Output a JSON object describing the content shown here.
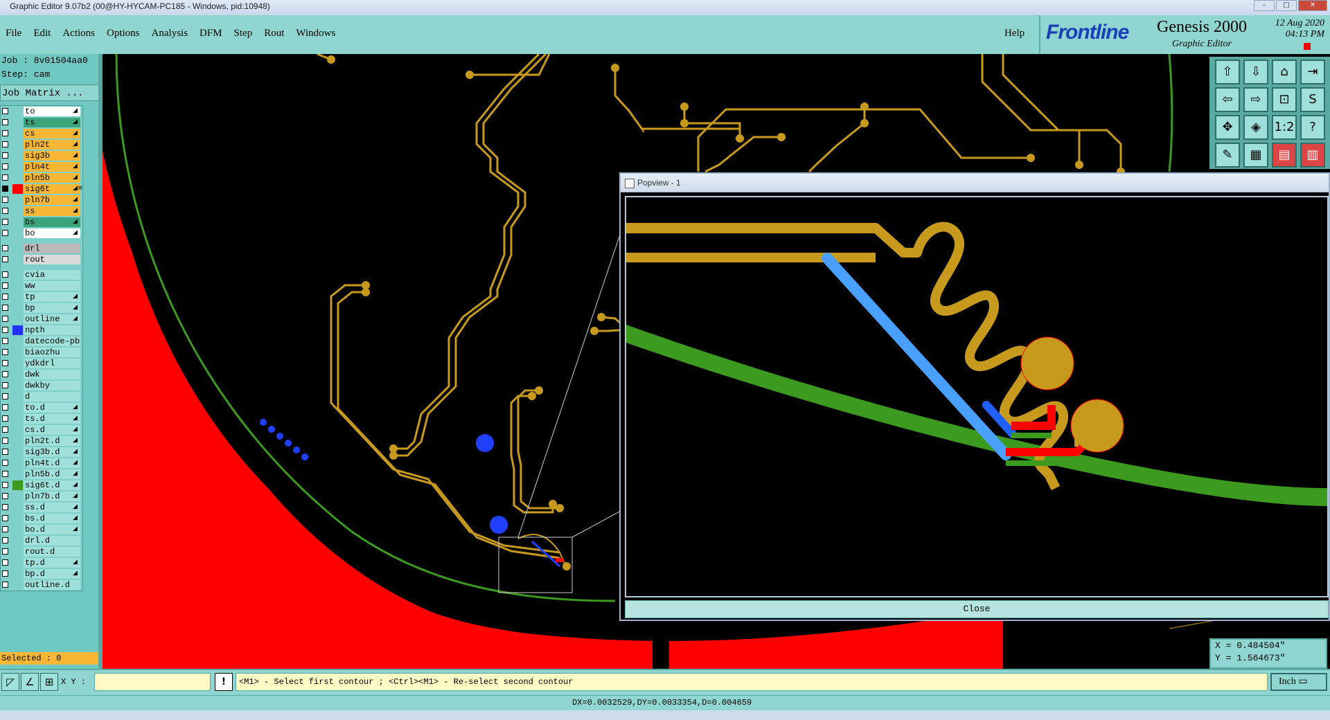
{
  "window": {
    "title": "Graphic Editor 9.07b2 (00@HY-HYCAM-PC185 - Windows, pid:10948)"
  },
  "menu": {
    "items": [
      "File",
      "Edit",
      "Actions",
      "Options",
      "Analysis",
      "DFM",
      "Step",
      "Rout",
      "Windows"
    ],
    "help": "Help"
  },
  "brand": {
    "logo": "Frontline",
    "product": "Genesis 2000",
    "subtitle": "Graphic Editor",
    "date": "12 Aug 2020",
    "time": "04:13 PM"
  },
  "job": {
    "job_label": "Job : 8v01504aa0",
    "step_label": "Step: cam",
    "matrix_button": "Job Matrix ..."
  },
  "layers": [
    {
      "name": "to",
      "color": "#ffffff",
      "sel": "",
      "flag": "◢"
    },
    {
      "name": "ts",
      "color": "#3aa57a",
      "sel": "",
      "flag": "◢"
    },
    {
      "name": "cs",
      "color": "#f7b735",
      "sel": "",
      "flag": "◢"
    },
    {
      "name": "pln2t",
      "color": "#f7b735",
      "sel": "",
      "flag": "◢"
    },
    {
      "name": "sig3b",
      "color": "#f7b735",
      "sel": "",
      "flag": "◢"
    },
    {
      "name": "pln4t",
      "color": "#f7b735",
      "sel": "",
      "flag": "◢"
    },
    {
      "name": "pln5b",
      "color": "#f7b735",
      "sel": "",
      "flag": "◢"
    },
    {
      "name": "sig6t",
      "color": "#f7b735",
      "sel": "#ff0000",
      "flag": "◢≡",
      "current": true
    },
    {
      "name": "pln7b",
      "color": "#f7b735",
      "sel": "",
      "flag": "◢"
    },
    {
      "name": "ss",
      "color": "#f7b735",
      "sel": "",
      "flag": "◢"
    },
    {
      "name": "bs",
      "color": "#3aa57a",
      "sel": "",
      "flag": "◢"
    },
    {
      "name": "bo",
      "color": "#ffffff",
      "sel": "",
      "flag": "◢"
    },
    {
      "gap": true
    },
    {
      "name": "drl",
      "color": "#b9b9b9",
      "sel": "",
      "flag": ""
    },
    {
      "name": "rout",
      "color": "#d9d9d9",
      "sel": "",
      "flag": ""
    },
    {
      "gap": true
    },
    {
      "name": "cvia",
      "color": "#9fe0da",
      "sel": "",
      "flag": ""
    },
    {
      "name": "ww",
      "color": "#9fe0da",
      "sel": "",
      "flag": ""
    },
    {
      "name": "tp",
      "color": "#9fe0da",
      "sel": "",
      "flag": "◢"
    },
    {
      "name": "bp",
      "color": "#9fe0da",
      "sel": "",
      "flag": "◢"
    },
    {
      "name": "outline",
      "color": "#9fe0da",
      "sel": "",
      "flag": "◢"
    },
    {
      "name": "npth",
      "color": "#9fe0da",
      "sel": "#2233ff",
      "flag": ""
    },
    {
      "name": "datecode-pbo",
      "color": "#9fe0da",
      "sel": "",
      "flag": ""
    },
    {
      "name": "biaozhu",
      "color": "#9fe0da",
      "sel": "",
      "flag": ""
    },
    {
      "name": "ydkdrl",
      "color": "#9fe0da",
      "sel": "",
      "flag": ""
    },
    {
      "name": "dwk",
      "color": "#9fe0da",
      "sel": "",
      "flag": ""
    },
    {
      "name": "dwkby",
      "color": "#9fe0da",
      "sel": "",
      "flag": ""
    },
    {
      "name": "d",
      "color": "#9fe0da",
      "sel": "",
      "flag": ""
    },
    {
      "name": "to.d",
      "color": "#9fe0da",
      "sel": "",
      "flag": "◢"
    },
    {
      "name": "ts.d",
      "color": "#9fe0da",
      "sel": "",
      "flag": "◢"
    },
    {
      "name": "cs.d",
      "color": "#9fe0da",
      "sel": "",
      "flag": "◢"
    },
    {
      "name": "pln2t.d",
      "color": "#9fe0da",
      "sel": "",
      "flag": "◢"
    },
    {
      "name": "sig3b.d",
      "color": "#9fe0da",
      "sel": "",
      "flag": "◢"
    },
    {
      "name": "pln4t.d",
      "color": "#9fe0da",
      "sel": "",
      "flag": "◢"
    },
    {
      "name": "pln5b.d",
      "color": "#9fe0da",
      "sel": "",
      "flag": "◢"
    },
    {
      "name": "sig6t.d",
      "color": "#9fe0da",
      "sel": "#3c9a1e",
      "flag": "◢"
    },
    {
      "name": "pln7b.d",
      "color": "#9fe0da",
      "sel": "",
      "flag": "◢"
    },
    {
      "name": "ss.d",
      "color": "#9fe0da",
      "sel": "",
      "flag": "◢"
    },
    {
      "name": "bs.d",
      "color": "#9fe0da",
      "sel": "",
      "flag": "◢"
    },
    {
      "name": "bo.d",
      "color": "#9fe0da",
      "sel": "",
      "flag": "◢"
    },
    {
      "name": "drl.d",
      "color": "#9fe0da",
      "sel": "",
      "flag": ""
    },
    {
      "name": "rout.d",
      "color": "#9fe0da",
      "sel": "",
      "flag": ""
    },
    {
      "name": "tp.d",
      "color": "#9fe0da",
      "sel": "",
      "flag": "◢"
    },
    {
      "name": "bp.d",
      "color": "#9fe0da",
      "sel": "",
      "flag": "◢"
    },
    {
      "name": "outline.d",
      "color": "#9fe0da",
      "sel": "",
      "flag": ""
    }
  ],
  "selected": "Selected : 0",
  "popview": {
    "title": "Popview - 1",
    "close": "Close"
  },
  "coords": {
    "x": "X = 0.484504\"",
    "y": "Y = 1.564673\""
  },
  "command": {
    "xy_label": "X Y :",
    "xy_value": "",
    "prompt": "<M1> - Select first contour ; <Ctrl><M1> - Re-select second contour",
    "units": "Inch",
    "bang": "!"
  },
  "status": "DX=0.0032529,DY=0.0033354,D=0.004659",
  "toolbox": [
    {
      "name": "shift-up-icon",
      "g": "⇧"
    },
    {
      "name": "shift-down-icon",
      "g": "⇩"
    },
    {
      "name": "home-icon",
      "g": "⌂"
    },
    {
      "name": "pan-right-icon",
      "g": "⇥"
    },
    {
      "name": "shift-left-icon",
      "g": "⇦"
    },
    {
      "name": "shift-right-icon",
      "g": "⇨"
    },
    {
      "name": "zoom-box-icon",
      "g": "⊡"
    },
    {
      "name": "snap-icon",
      "g": "S"
    },
    {
      "name": "fit-icon",
      "g": "✥"
    },
    {
      "name": "center-icon",
      "g": "◈"
    },
    {
      "name": "scale-icon",
      "g": "1:2"
    },
    {
      "name": "help-icon",
      "g": "?"
    },
    {
      "name": "measure-icon",
      "g": "✎"
    },
    {
      "name": "grid-icon",
      "g": "▦"
    },
    {
      "name": "layer-a-icon",
      "g": "▤",
      "sel": true
    },
    {
      "name": "layer-b-icon",
      "g": "▥",
      "sel": true
    }
  ],
  "colors": {
    "copper": "#c79a1e",
    "red": "#ff0000",
    "green": "#3c9a1e",
    "blue": "#2040ff",
    "panel": "#8fd6d0"
  }
}
